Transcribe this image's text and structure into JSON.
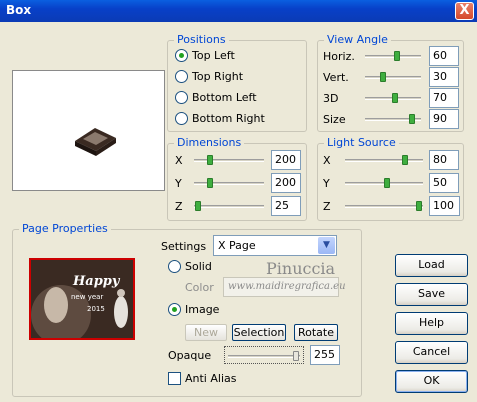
{
  "window": {
    "title": "Box",
    "close_label": "X"
  },
  "positions": {
    "title": "Positions",
    "options": [
      "Top Left",
      "Top Right",
      "Bottom Left",
      "Bottom Right"
    ],
    "selected": "Top Left"
  },
  "view_angle": {
    "title": "View Angle",
    "rows": [
      {
        "label": "Horiz.",
        "value": "60",
        "level": 0.6
      },
      {
        "label": "Vert.",
        "value": "30",
        "level": 0.3
      },
      {
        "label": "3D",
        "value": "70",
        "level": 0.55
      },
      {
        "label": "Size",
        "value": "90",
        "level": 0.9
      }
    ]
  },
  "dimensions": {
    "title": "Dimensions",
    "rows": [
      {
        "label": "X",
        "value": "200",
        "level": 0.2
      },
      {
        "label": "Y",
        "value": "200",
        "level": 0.2
      },
      {
        "label": "Z",
        "value": "25",
        "level": 0.02
      }
    ]
  },
  "light_source": {
    "title": "Light Source",
    "rows": [
      {
        "label": "X",
        "value": "80",
        "level": 0.8
      },
      {
        "label": "Y",
        "value": "50",
        "level": 0.55
      },
      {
        "label": "Z",
        "value": "100",
        "level": 1.0
      }
    ]
  },
  "page_properties": {
    "title": "Page Properties",
    "settings_label": "Settings",
    "settings_value": "X Page",
    "solid_label": "Solid",
    "color_label": "Color",
    "image_label": "Image",
    "fill_selected": "Image",
    "new_label": "New",
    "selection_label": "Selection",
    "rotate_label": "Rotate",
    "opaque_label": "Opaque",
    "opaque_value": "255",
    "opaque_level": 1.0,
    "anti_alias_label": "Anti Alias",
    "anti_alias_checked": false,
    "image_text_1": "Happy",
    "image_text_2": "new year",
    "image_text_3": "2015"
  },
  "watermark": {
    "name": "Pinuccia",
    "url": "www.maidiregrafica.eu"
  },
  "buttons": {
    "load": "Load",
    "save": "Save",
    "help": "Help",
    "cancel": "Cancel",
    "ok": "OK"
  }
}
